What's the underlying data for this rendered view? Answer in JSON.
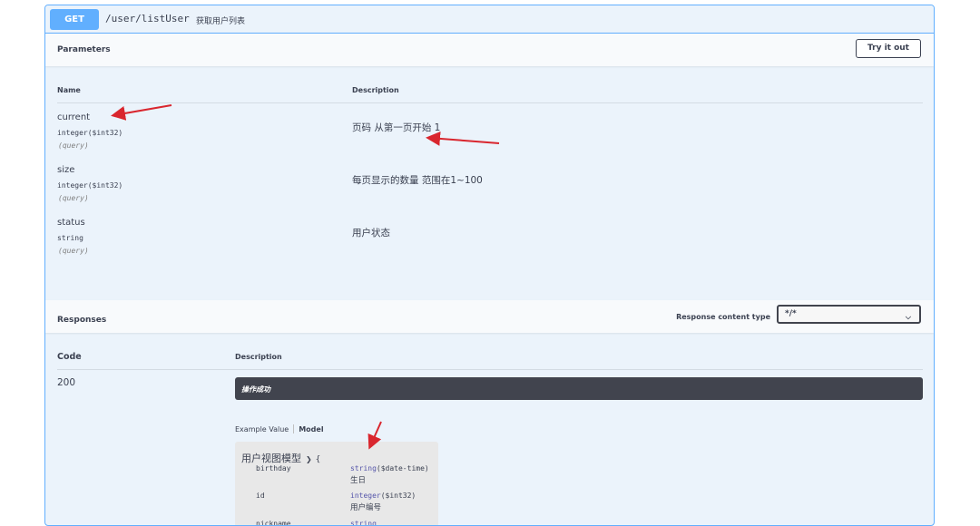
{
  "operation": {
    "method": "GET",
    "path": "/user/listUser",
    "summary": "获取用户列表"
  },
  "parameters": {
    "title": "Parameters",
    "try_button": "Try it out",
    "col_name": "Name",
    "col_description": "Description",
    "items": [
      {
        "name": "current",
        "type": "integer",
        "format": "($int32)",
        "in": "(query)",
        "description": "页码 从第一页开始 1"
      },
      {
        "name": "size",
        "type": "integer",
        "format": "($int32)",
        "in": "(query)",
        "description": "每页显示的数量 范围在1~100"
      },
      {
        "name": "status",
        "type": "string",
        "format": "",
        "in": "(query)",
        "description": "用户状态"
      }
    ]
  },
  "responses": {
    "title": "Responses",
    "content_type_label": "Response content type",
    "content_type_value": "*/*",
    "col_code": "Code",
    "col_description": "Description",
    "rows": [
      {
        "code": "200",
        "description": "操作成功"
      }
    ],
    "tabs": {
      "example": "Example Value",
      "model": "Model"
    },
    "model": {
      "title": "用户视图模型",
      "brace": "{",
      "properties": [
        {
          "name": "birthday",
          "type": "string",
          "format": "($date-time)",
          "description": "生日"
        },
        {
          "name": "id",
          "type": "integer",
          "format": "($int32)",
          "description": "用户编号"
        },
        {
          "name": "nickname",
          "type": "string",
          "format": "",
          "description": ""
        }
      ]
    }
  },
  "colors": {
    "get_accent": "#61affe",
    "block_bg": "#ebf3fb",
    "annotation_arrow": "#d9262e"
  }
}
